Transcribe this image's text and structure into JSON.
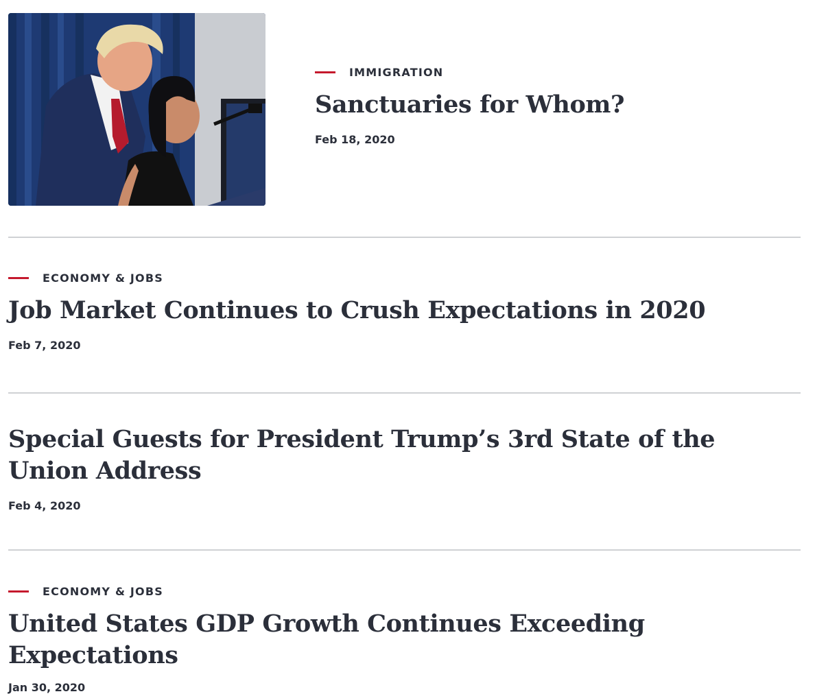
{
  "articles": [
    {
      "category": "IMMIGRATION",
      "title": "Sanctuaries for Whom?",
      "date": "Feb 18, 2020"
    },
    {
      "category": "ECONOMY & JOBS",
      "title": "Job Market Continues to Crush Expectations in 2020",
      "date": "Feb 7, 2020"
    },
    {
      "category": "",
      "title": "Special Guests for President Trump’s 3rd State of the Union Address",
      "date": "Feb 4, 2020"
    },
    {
      "category": "ECONOMY & JOBS",
      "title": "United States GDP Growth Continues Exceeding Expectations",
      "date": "Jan 30, 2020"
    }
  ],
  "colors": {
    "accent": "#c5192d",
    "text": "#2b2f3a",
    "divider": "#cfd1d4"
  }
}
